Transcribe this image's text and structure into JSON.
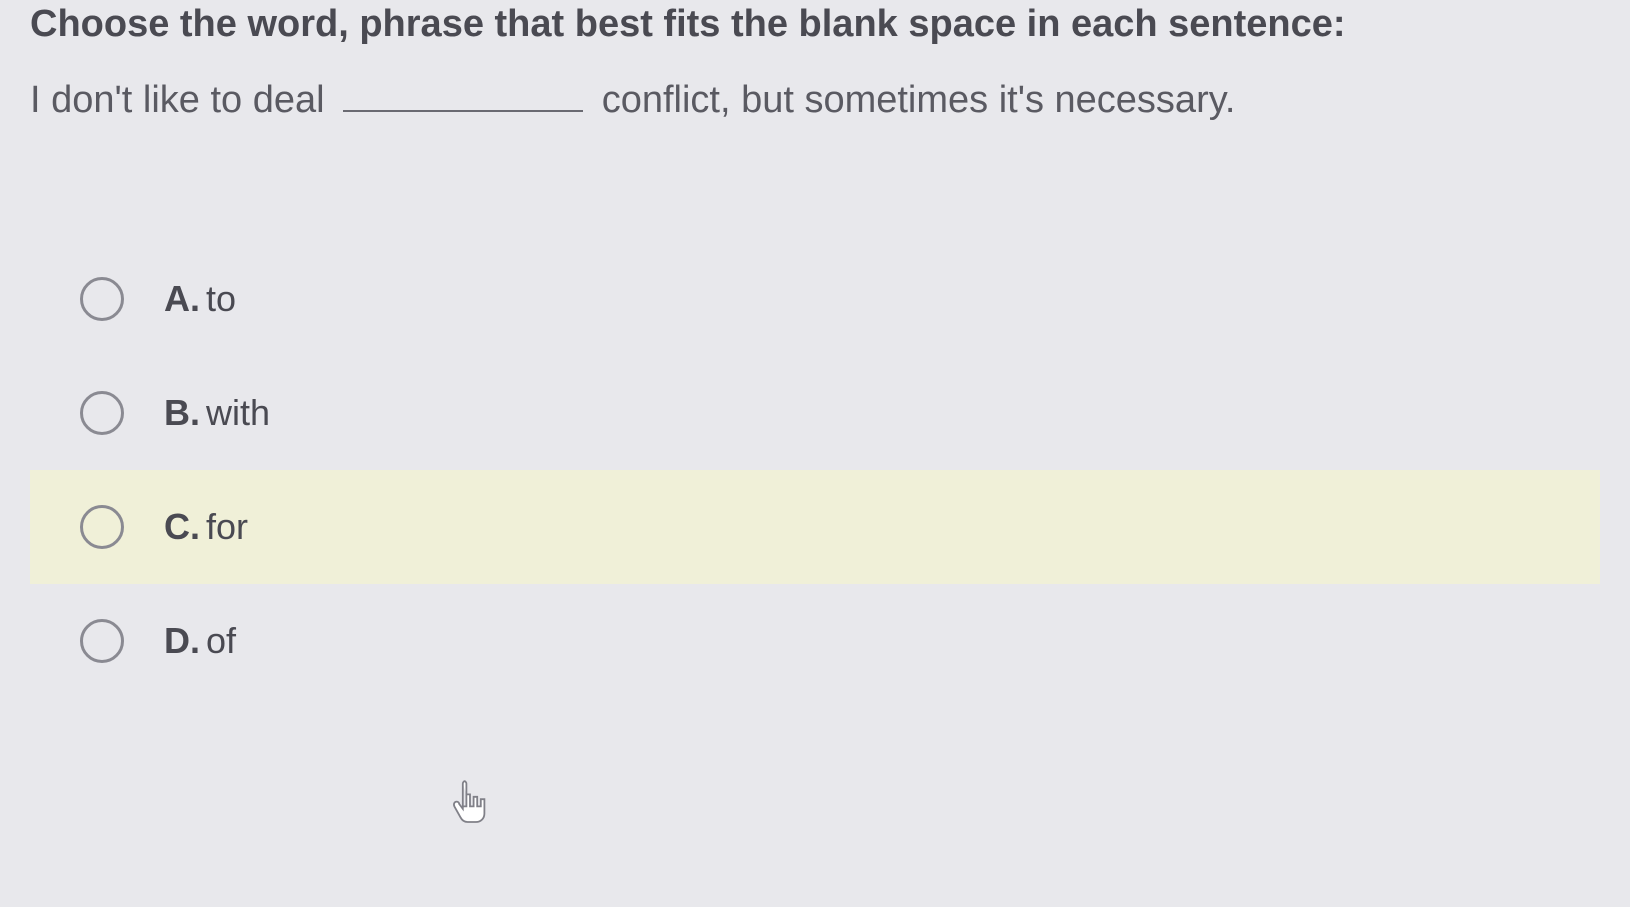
{
  "instruction": "Choose the word, phrase that best fits the blank space in each sentence:",
  "sentence_before": "I don't like to deal",
  "sentence_after": "conflict, but sometimes it's necessary.",
  "options": [
    {
      "letter": "A.",
      "text": "to",
      "highlighted": false
    },
    {
      "letter": "B.",
      "text": "with",
      "highlighted": false
    },
    {
      "letter": "C.",
      "text": "for",
      "highlighted": true
    },
    {
      "letter": "D.",
      "text": "of",
      "highlighted": false
    }
  ]
}
